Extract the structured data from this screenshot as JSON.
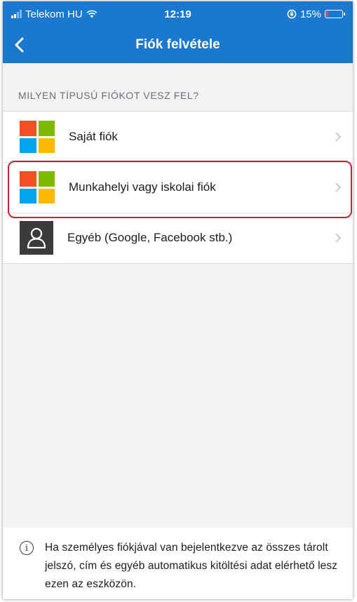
{
  "status_bar": {
    "carrier": "Telekom HU",
    "time": "12:19",
    "battery_percent": "15%",
    "battery_level": 0.15,
    "icons": [
      "signal-icon",
      "wifi-icon",
      "rotation-lock-icon",
      "battery-icon"
    ]
  },
  "nav": {
    "title": "Fiók felvétele",
    "back_icon": "chevron-left-icon"
  },
  "section_header": "MILYEN TÍPUSÚ FIÓKOT VESZ FEL?",
  "accounts": [
    {
      "label": "Saját fiók",
      "icon": "microsoft-logo-icon"
    },
    {
      "label": "Munkahelyi vagy iskolai fiók",
      "icon": "microsoft-logo-icon",
      "highlighted": true
    },
    {
      "label": "Egyéb (Google, Facebook stb.)",
      "icon": "person-icon"
    }
  ],
  "footer": {
    "icon": "info-icon",
    "text": "Ha személyes fiókjával van bejelentkezve az összes tárolt jelszó, cím és egyéb automatikus kitöltési adat elérhető lesz ezen az eszközön."
  },
  "colors": {
    "brand_blue": "#1a78cf",
    "highlight_red": "#c8203a",
    "ms_red": "#f25022",
    "ms_green": "#7fba00",
    "ms_blue": "#00a4ef",
    "ms_yellow": "#ffb900"
  }
}
